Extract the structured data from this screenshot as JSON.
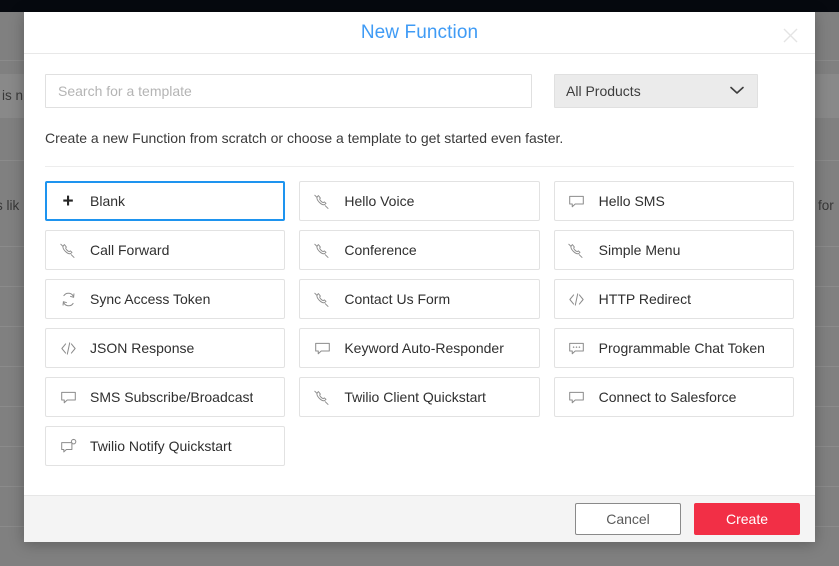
{
  "background": {
    "fragment_left_top": "is n",
    "fragment_left_mid": "s lik",
    "fragment_right": "for",
    "topbar_color": "#06090f",
    "overlay_color": "#808080"
  },
  "modal": {
    "title": "New Function",
    "close_icon": "close-icon",
    "search": {
      "placeholder": "Search for a template",
      "value": ""
    },
    "product_filter": {
      "selected": "All Products",
      "chevron_icon": "chevron-down-icon"
    },
    "subtitle": "Create a new Function from scratch or choose a template to get started even faster.",
    "templates": [
      {
        "label": "Blank",
        "icon": "plus-icon",
        "selected": true
      },
      {
        "label": "Hello Voice",
        "icon": "phone-icon",
        "selected": false
      },
      {
        "label": "Hello SMS",
        "icon": "message-icon",
        "selected": false
      },
      {
        "label": "Call Forward",
        "icon": "phone-icon",
        "selected": false
      },
      {
        "label": "Conference",
        "icon": "phone-icon",
        "selected": false
      },
      {
        "label": "Simple Menu",
        "icon": "phone-icon",
        "selected": false
      },
      {
        "label": "Sync Access Token",
        "icon": "sync-icon",
        "selected": false
      },
      {
        "label": "Contact Us Form",
        "icon": "phone-icon",
        "selected": false
      },
      {
        "label": "HTTP Redirect",
        "icon": "code-icon",
        "selected": false
      },
      {
        "label": "JSON Response",
        "icon": "code-icon",
        "selected": false
      },
      {
        "label": "Keyword Auto-Responder",
        "icon": "message-icon",
        "selected": false
      },
      {
        "label": "Programmable Chat Token",
        "icon": "chat-dots-icon",
        "selected": false
      },
      {
        "label": "SMS Subscribe/Broadcast",
        "icon": "message-icon",
        "selected": false
      },
      {
        "label": "Twilio Client Quickstart",
        "icon": "phone-icon",
        "selected": false
      },
      {
        "label": "Connect to Salesforce",
        "icon": "message-icon",
        "selected": false
      },
      {
        "label": "Twilio Notify Quickstart",
        "icon": "message-badge-icon",
        "selected": false
      }
    ],
    "footer": {
      "cancel_label": "Cancel",
      "create_label": "Create",
      "create_color": "#f22f46"
    }
  }
}
